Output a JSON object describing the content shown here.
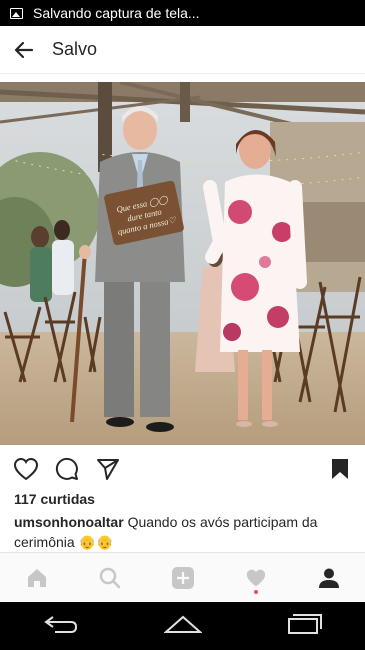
{
  "status_bar": {
    "notification": "Salvando captura de tela..."
  },
  "header": {
    "title": "Salvo"
  },
  "post": {
    "sign_text": "Que essa dure tanto quanto a nossa",
    "likes": "117 curtidas",
    "username": "umsonhonoaltar",
    "caption": "Quando os avós participam da cerimônia",
    "emoji": "👴👴"
  }
}
